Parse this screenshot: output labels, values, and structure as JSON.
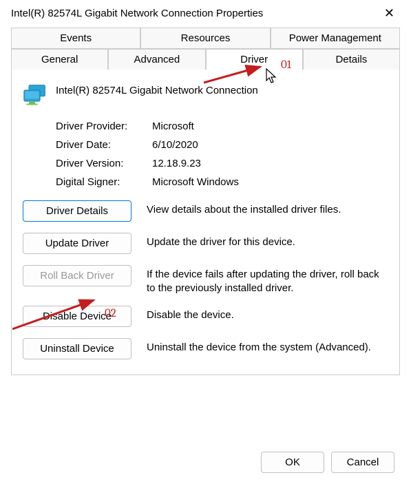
{
  "window": {
    "title": "Intel(R) 82574L Gigabit Network Connection Properties"
  },
  "tabs": {
    "row1": [
      "Events",
      "Resources",
      "Power Management"
    ],
    "row2": [
      "General",
      "Advanced",
      "Driver",
      "Details"
    ],
    "active": "Driver"
  },
  "device": {
    "name": "Intel(R) 82574L Gigabit Network Connection"
  },
  "info": {
    "provider_label": "Driver Provider:",
    "provider_value": "Microsoft",
    "date_label": "Driver Date:",
    "date_value": "6/10/2020",
    "version_label": "Driver Version:",
    "version_value": "12.18.9.23",
    "signer_label": "Digital Signer:",
    "signer_value": "Microsoft Windows"
  },
  "actions": {
    "details": {
      "label": "Driver Details",
      "desc": "View details about the installed driver files."
    },
    "update": {
      "label": "Update Driver",
      "desc": "Update the driver for this device."
    },
    "rollback": {
      "label": "Roll Back Driver",
      "desc": "If the device fails after updating the driver, roll back to the previously installed driver."
    },
    "disable": {
      "label": "Disable Device",
      "desc": "Disable the device."
    },
    "uninstall": {
      "label": "Uninstall Device",
      "desc": "Uninstall the device from the system (Advanced)."
    }
  },
  "footer": {
    "ok": "OK",
    "cancel": "Cancel"
  },
  "annotations": {
    "a1": "01",
    "a2": "02"
  }
}
